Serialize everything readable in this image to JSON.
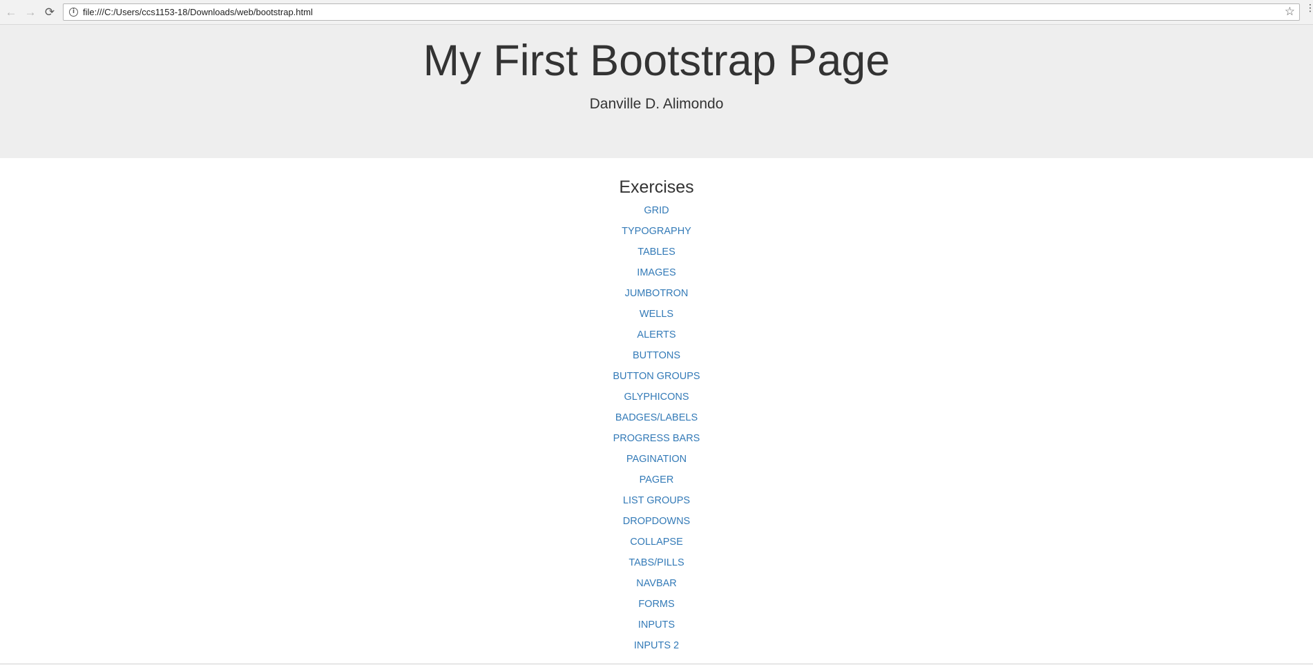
{
  "browser": {
    "url": "file:///C:/Users/ccs1153-18/Downloads/web/bootstrap.html",
    "icons": {
      "back": "arrow-left-icon",
      "forward": "arrow-right-icon",
      "reload": "reload-icon",
      "info": "info-icon",
      "bookmark": "star-icon",
      "menu": "kebab-menu-icon"
    }
  },
  "jumbotron": {
    "title": "My First Bootstrap Page",
    "author": "Danville D. Alimondo"
  },
  "exercises": {
    "heading": "Exercises",
    "links": [
      {
        "label": "GRID"
      },
      {
        "label": "TYPOGRAPHY"
      },
      {
        "label": "TABLES"
      },
      {
        "label": "IMAGES"
      },
      {
        "label": "JUMBOTRON"
      },
      {
        "label": "WELLS"
      },
      {
        "label": "ALERTS"
      },
      {
        "label": "BUTTONS"
      },
      {
        "label": "BUTTON GROUPS"
      },
      {
        "label": "GLYPHICONS"
      },
      {
        "label": "BADGES/LABELS"
      },
      {
        "label": "PROGRESS BARS"
      },
      {
        "label": "PAGINATION"
      },
      {
        "label": "PAGER"
      },
      {
        "label": "LIST GROUPS"
      },
      {
        "label": "DROPDOWNS"
      },
      {
        "label": "COLLAPSE"
      },
      {
        "label": "TABS/PILLS"
      },
      {
        "label": "NAVBAR"
      },
      {
        "label": "FORMS"
      },
      {
        "label": "INPUTS"
      },
      {
        "label": "INPUTS 2"
      }
    ]
  },
  "colors": {
    "link": "#337ab7",
    "jumbotron_bg": "#eeeeee",
    "text": "#333333"
  }
}
